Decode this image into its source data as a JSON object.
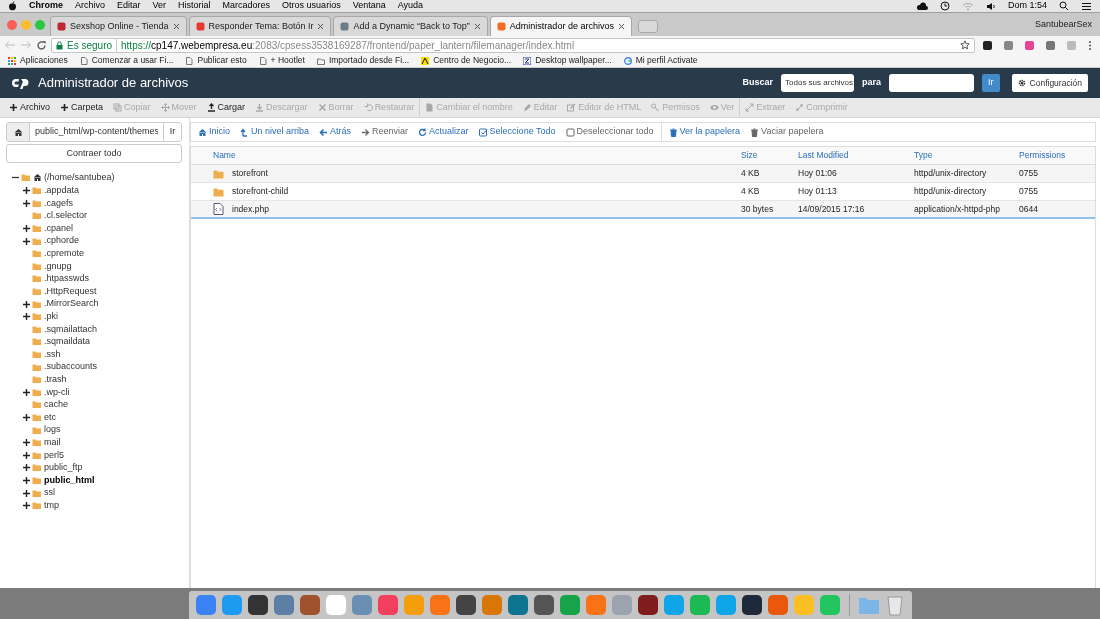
{
  "menu_bar": {
    "app": "Chrome",
    "items": [
      "Archivo",
      "Editar",
      "Ver",
      "Historial",
      "Marcadores",
      "Otros usuarios",
      "Ventana",
      "Ayuda"
    ],
    "clock": "Dom 1:54"
  },
  "browser": {
    "tabs": [
      {
        "title": "Sexshop Online - Tienda",
        "selected": false
      },
      {
        "title": "Responder Tema: Botón Ir",
        "selected": false
      },
      {
        "title": "Add a Dynamic “Back to Top”",
        "selected": false
      },
      {
        "title": "Administrador de archivos",
        "selected": true
      }
    ],
    "profile": "SantubearSex",
    "address": {
      "secure_label": "Es seguro",
      "scheme": "https://",
      "host": "cp147.webempresa.eu",
      "rest": ":2083/cpsess3538169287/frontend/paper_lantern/filemanager/index.html"
    },
    "bookmarks": [
      "Aplicaciones",
      "Comenzar a usar Fi...",
      "Publicar esto",
      "+ Hootlet",
      "Importado desde Fi...",
      "Centro de Negocio...",
      "Desktop wallpaper...",
      "Mi perfil Activate"
    ]
  },
  "app": {
    "title": "Administrador de archivos",
    "search": {
      "label": "Buscar",
      "scope": "Todos sus archivos",
      "for_label": "para",
      "go": "Ir"
    },
    "settings": "Configuración",
    "toolbar_groups": [
      {
        "items": [
          {
            "label": "Archivo",
            "disabled": false
          },
          {
            "label": "Carpeta",
            "disabled": false
          },
          {
            "label": "Copiar",
            "disabled": true
          },
          {
            "label": "Mover",
            "disabled": true
          },
          {
            "label": "Cargar",
            "disabled": false
          },
          {
            "label": "Descargar",
            "disabled": true
          },
          {
            "label": "Borrar",
            "disabled": true
          },
          {
            "label": "Restaurar",
            "disabled": true
          }
        ]
      },
      {
        "items": [
          {
            "label": "Cambiar el nombre",
            "disabled": true
          },
          {
            "label": "Editar",
            "disabled": true
          },
          {
            "label": "Editor de HTML",
            "disabled": true
          },
          {
            "label": "Permisos",
            "disabled": true
          },
          {
            "label": "Ver",
            "disabled": true
          }
        ]
      },
      {
        "items": [
          {
            "label": "Extraer",
            "disabled": true
          },
          {
            "label": "Comprimir",
            "disabled": true
          }
        ]
      }
    ],
    "path": {
      "value": "public_html/wp-content/themes",
      "go": "Ir"
    },
    "nav_groups": [
      {
        "items": [
          {
            "label": "Inicio",
            "disabled": false
          },
          {
            "label": "Un nivel arriba",
            "disabled": false
          },
          {
            "label": "Atrás",
            "disabled": false
          },
          {
            "label": "Reenviar",
            "disabled": true
          },
          {
            "label": "Actualizar",
            "disabled": false
          },
          {
            "label": "Seleccione Todo",
            "disabled": false
          },
          {
            "label": "Deseleccionar todo",
            "disabled": true
          }
        ]
      },
      {
        "items": [
          {
            "label": "Ver la papelera",
            "disabled": false
          },
          {
            "label": "Vaciar papelera",
            "disabled": true
          }
        ]
      }
    ],
    "tree": {
      "collapse_button": "Contraer todo",
      "root": {
        "label": "(/home/santubea)",
        "expanded": true,
        "children": [
          {
            "label": ".appdata",
            "expandable": true,
            "selected": false
          },
          {
            "label": ".cagefs",
            "expandable": true,
            "selected": false
          },
          {
            "label": ".cl.selector",
            "expandable": false,
            "selected": false
          },
          {
            "label": ".cpanel",
            "expandable": true,
            "selected": false
          },
          {
            "label": ".cphorde",
            "expandable": true,
            "selected": false
          },
          {
            "label": ".cpremote",
            "expandable": false,
            "selected": false
          },
          {
            "label": ".gnupg",
            "expandable": false,
            "selected": false
          },
          {
            "label": ".htpasswds",
            "expandable": false,
            "selected": false
          },
          {
            "label": ".HttpRequest",
            "expandable": false,
            "selected": false
          },
          {
            "label": ".MirrorSearch",
            "expandable": true,
            "selected": false
          },
          {
            "label": ".pki",
            "expandable": true,
            "selected": false
          },
          {
            "label": ".sqmailattach",
            "expandable": false,
            "selected": false
          },
          {
            "label": ".sqmaildata",
            "expandable": false,
            "selected": false
          },
          {
            "label": ".ssh",
            "expandable": false,
            "selected": false
          },
          {
            "label": ".subaccounts",
            "expandable": false,
            "selected": false
          },
          {
            "label": ".trash",
            "expandable": false,
            "selected": false
          },
          {
            "label": ".wp-cli",
            "expandable": true,
            "selected": false
          },
          {
            "label": "cache",
            "expandable": false,
            "selected": false
          },
          {
            "label": "etc",
            "expandable": true,
            "selected": false
          },
          {
            "label": "logs",
            "expandable": false,
            "selected": false
          },
          {
            "label": "mail",
            "expandable": true,
            "selected": false
          },
          {
            "label": "perl5",
            "expandable": true,
            "selected": false
          },
          {
            "label": "public_ftp",
            "expandable": true,
            "selected": false
          },
          {
            "label": "public_html",
            "expandable": true,
            "selected": true
          },
          {
            "label": "ssl",
            "expandable": true,
            "selected": false
          },
          {
            "label": "tmp",
            "expandable": true,
            "selected": false
          }
        ]
      }
    },
    "table": {
      "columns": [
        "Name",
        "Size",
        "Last Modified",
        "Type",
        "Permissions"
      ],
      "rows": [
        {
          "kind": "folder",
          "name": "storefront",
          "size": "4 KB",
          "modified": "Hoy 01:06",
          "type": "httpd/unix-directory",
          "permissions": "0755"
        },
        {
          "kind": "folder",
          "name": "storefront-child",
          "size": "4 KB",
          "modified": "Hoy 01:13",
          "type": "httpd/unix-directory",
          "permissions": "0755"
        },
        {
          "kind": "file",
          "name": "index.php",
          "size": "30 bytes",
          "modified": "14/09/2015 17:16",
          "type": "application/x-httpd-php",
          "permissions": "0644"
        }
      ]
    }
  }
}
